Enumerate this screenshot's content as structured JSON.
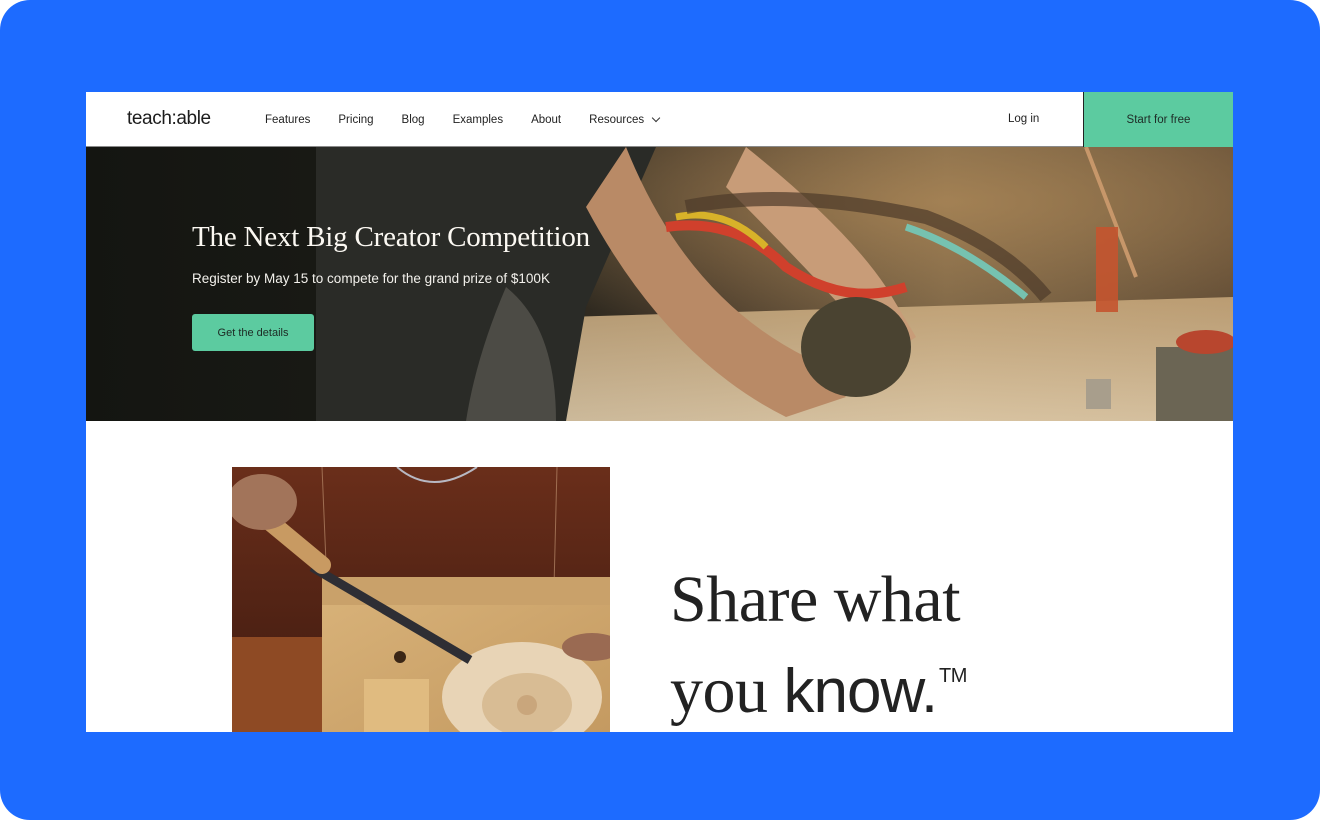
{
  "brand": {
    "logo_text": "teach:able",
    "accent": "#5ccba0",
    "frame_bg": "#1d6bff"
  },
  "nav": {
    "links": [
      {
        "label": "Features"
      },
      {
        "label": "Pricing"
      },
      {
        "label": "Blog"
      },
      {
        "label": "Examples"
      },
      {
        "label": "About"
      },
      {
        "label": "Resources",
        "icon": "chevron-down-icon"
      }
    ],
    "login_label": "Log in",
    "cta_label": "Start for free"
  },
  "hero": {
    "title": "The Next Big Creator Competition",
    "subtitle": "Register by May 15 to compete for the grand prize of $100K",
    "button_label": "Get the details",
    "image_alt": "Hands working with tools and colorful cables on a workbench"
  },
  "intro": {
    "image_alt": "Hands carving a wooden plate with a chisel",
    "tagline_line1": "Share what",
    "tagline_line2_serif": "you ",
    "tagline_line2_sans": "know.",
    "trademark": "TM"
  }
}
